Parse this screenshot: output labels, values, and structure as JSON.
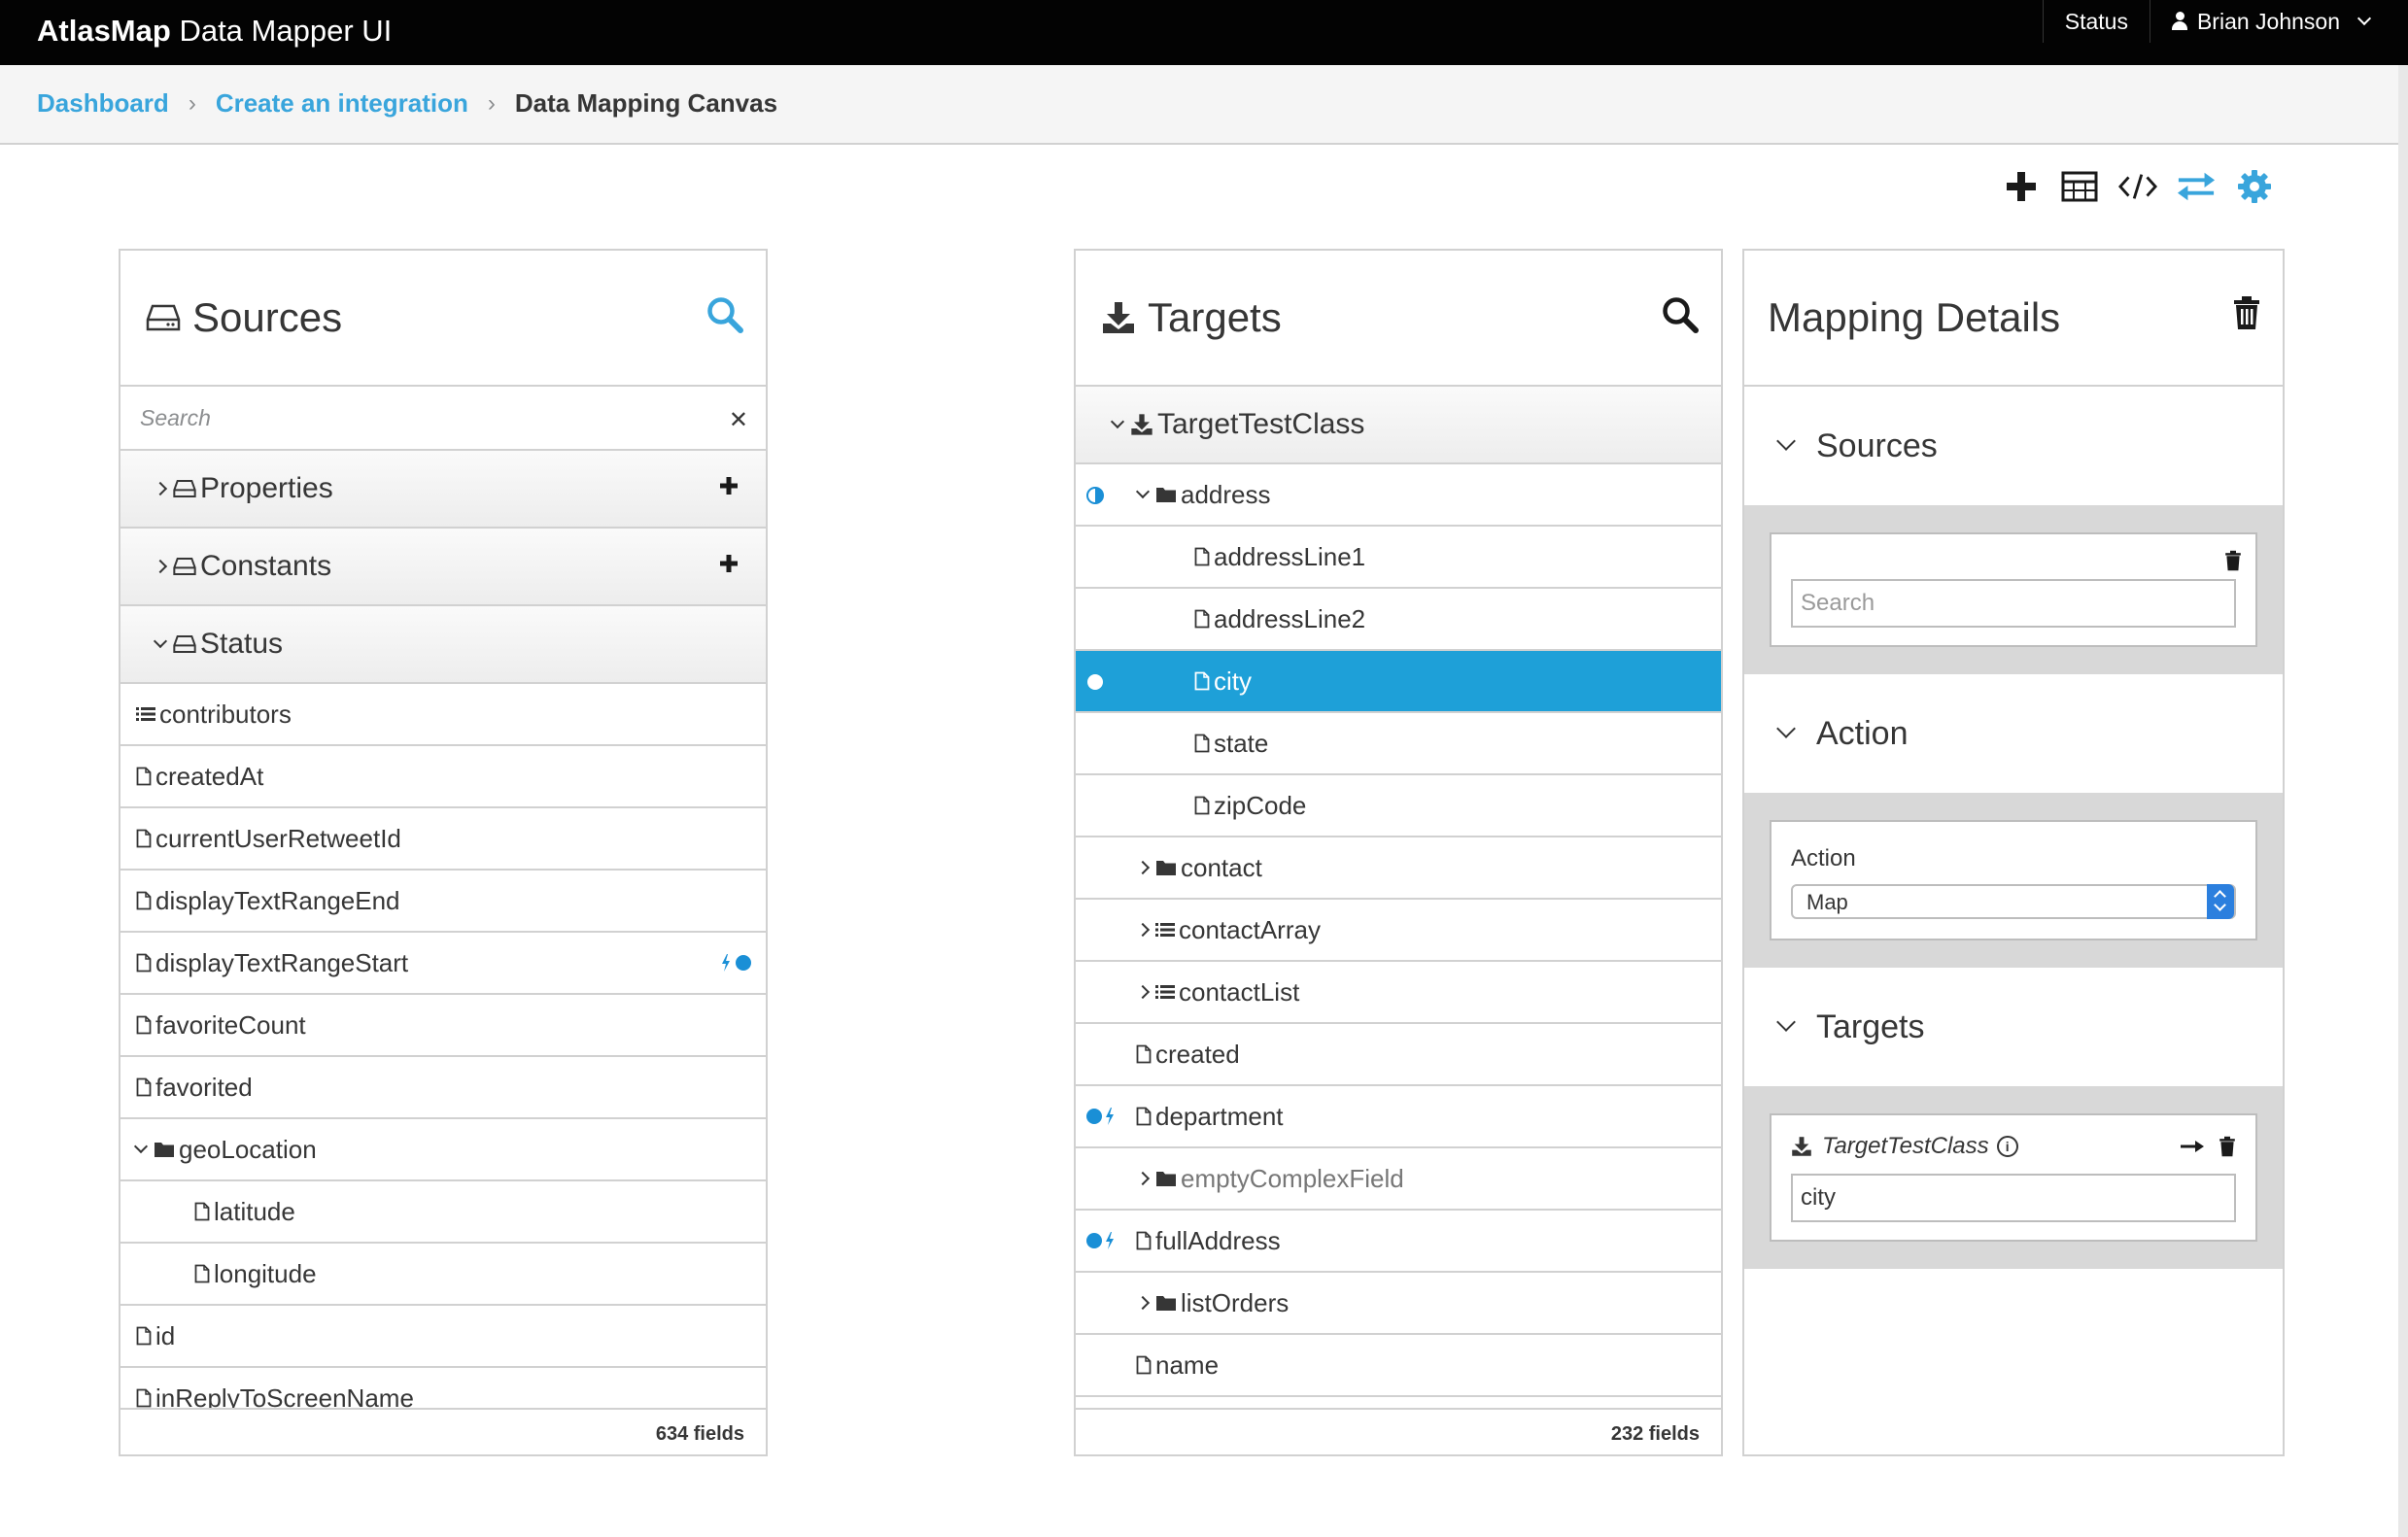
{
  "app": {
    "brand_bold": "AtlasMap",
    "brand_rest": "Data Mapper UI",
    "status_label": "Status",
    "user_name": "Brian Johnson"
  },
  "breadcrumb": {
    "items": [
      "Dashboard",
      "Create an integration",
      "Data Mapping Canvas"
    ]
  },
  "toolbar": {
    "icons": [
      "plus-icon",
      "table-icon",
      "code-icon",
      "exchange-icon",
      "gear-icon"
    ],
    "accent_color": "#39a5dc"
  },
  "sources": {
    "title": "Sources",
    "search_placeholder": "Search",
    "groups": [
      {
        "label": "Properties",
        "expanded": false
      },
      {
        "label": "Constants",
        "expanded": false
      },
      {
        "label": "Status",
        "expanded": true
      }
    ],
    "fields": [
      {
        "label": "contributors",
        "type": "list",
        "indent": 0
      },
      {
        "label": "createdAt",
        "type": "file",
        "indent": 0
      },
      {
        "label": "currentUserRetweetId",
        "type": "file",
        "indent": 0
      },
      {
        "label": "displayTextRangeEnd",
        "type": "file",
        "indent": 0
      },
      {
        "label": "displayTextRangeStart",
        "type": "file",
        "indent": 0,
        "mapped": true
      },
      {
        "label": "favoriteCount",
        "type": "file",
        "indent": 0
      },
      {
        "label": "favorited",
        "type": "file",
        "indent": 0
      },
      {
        "label": "geoLocation",
        "type": "folder",
        "indent": 0,
        "expanded": true
      },
      {
        "label": "latitude",
        "type": "file",
        "indent": 1
      },
      {
        "label": "longitude",
        "type": "file",
        "indent": 1
      },
      {
        "label": "id",
        "type": "file",
        "indent": 0
      },
      {
        "label": "inReplyToScreenName",
        "type": "file",
        "indent": 0
      }
    ],
    "count_label": "634 fields"
  },
  "targets": {
    "title": "Targets",
    "root": "TargetTestClass",
    "fields": [
      {
        "label": "address",
        "type": "folder",
        "indent": 1,
        "expanded": true,
        "marker": "half"
      },
      {
        "label": "addressLine1",
        "type": "file",
        "indent": 2
      },
      {
        "label": "addressLine2",
        "type": "file",
        "indent": 2
      },
      {
        "label": "city",
        "type": "file",
        "indent": 2,
        "selected": true,
        "marker": "selected"
      },
      {
        "label": "state",
        "type": "file",
        "indent": 2
      },
      {
        "label": "zipCode",
        "type": "file",
        "indent": 2
      },
      {
        "label": "contact",
        "type": "folder",
        "indent": 1,
        "expanded": false
      },
      {
        "label": "contactArray",
        "type": "list",
        "indent": 1,
        "expanded": false
      },
      {
        "label": "contactList",
        "type": "list",
        "indent": 1,
        "expanded": false
      },
      {
        "label": "created",
        "type": "file",
        "indent": 1
      },
      {
        "label": "department",
        "type": "file",
        "indent": 1,
        "marker": "mapped"
      },
      {
        "label": "emptyComplexField",
        "type": "folder",
        "indent": 1,
        "expanded": false,
        "muted": true
      },
      {
        "label": "fullAddress",
        "type": "file",
        "indent": 1,
        "marker": "mapped"
      },
      {
        "label": "listOrders",
        "type": "folder",
        "indent": 1,
        "expanded": false
      },
      {
        "label": "name",
        "type": "file",
        "indent": 1
      }
    ],
    "count_label": "232 fields"
  },
  "mapping": {
    "title": "Mapping Details",
    "sources_title": "Sources",
    "sources_search_placeholder": "Search",
    "action_title": "Action",
    "action_label": "Action",
    "action_value": "Map",
    "targets_title": "Targets",
    "target_class": "TargetTestClass",
    "target_field": "city"
  },
  "colors": {
    "accent": "#39a5dc",
    "selected_row": "#1ea0d8",
    "topbar": "#030303"
  }
}
